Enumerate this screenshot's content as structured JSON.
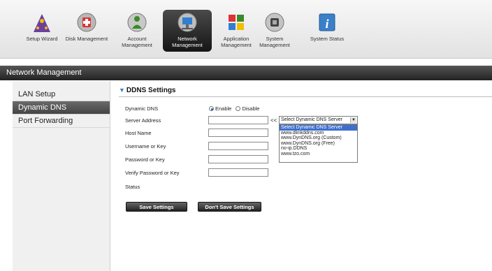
{
  "toolbar": {
    "items": [
      {
        "label": "Setup Wizard",
        "icon": "wizard-icon"
      },
      {
        "label": "Disk Management",
        "icon": "disk-icon"
      },
      {
        "label": "Account Management",
        "icon": "users-icon"
      },
      {
        "label": "Network Management",
        "icon": "network-icon"
      },
      {
        "label": "Application Management",
        "icon": "apps-icon"
      },
      {
        "label": "System Management",
        "icon": "system-icon"
      },
      {
        "label": "System Status",
        "icon": "info-icon"
      }
    ]
  },
  "section": {
    "title": "Network Management"
  },
  "sidebar": {
    "items": [
      {
        "label": "LAN Setup"
      },
      {
        "label": "Dynamic DNS"
      },
      {
        "label": "Port Forwarding"
      }
    ]
  },
  "ddns": {
    "title": "DDNS Settings",
    "dynamic_dns_label": "Dynamic DNS",
    "enable_label": "Enable",
    "disable_label": "Disable",
    "server_address_label": "Server Address",
    "arrows": "<<",
    "host_name_label": "Host Name",
    "username_label": "Username or Key",
    "password_label": "Password or Key",
    "verify_password_label": "Verify Password or Key",
    "status_label": "Status",
    "server_select": {
      "value": "Select Dynamic DNS Server",
      "options": [
        "Select Dynamic DNS Server",
        "www.dlinkddns.com",
        "www.DynDNS.org (Custom)",
        "www.DynDNS.org (Free)",
        "no-ip.DDNS",
        "www.tzo.com"
      ]
    },
    "save_label": "Save Settings",
    "dont_save_label": "Don't Save Settings"
  },
  "colors": {
    "accent": "#3d6fd0",
    "header_bg": "#333333"
  }
}
